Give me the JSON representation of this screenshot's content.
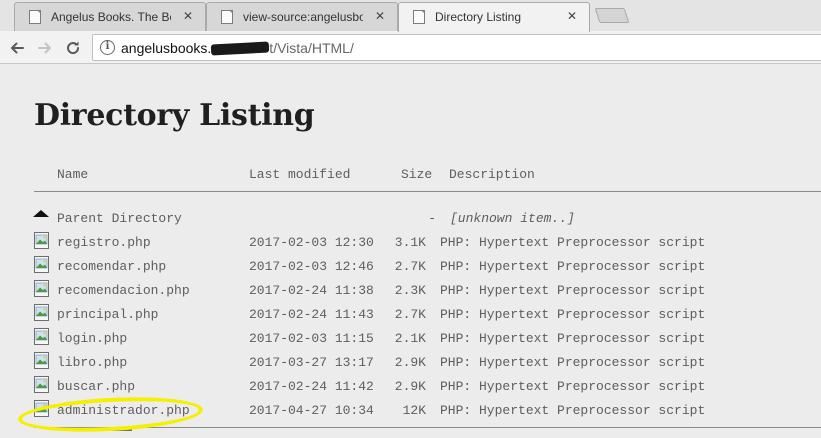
{
  "browser": {
    "tabs": [
      {
        "title": "Angelus Books. The Best",
        "active": false
      },
      {
        "title": "view-source:angelusbook",
        "active": false
      },
      {
        "title": "Directory Listing",
        "active": true
      }
    ],
    "close_glyph": "✕",
    "nav": {
      "back_icon": "back-arrow-icon",
      "forward_icon": "forward-arrow-icon",
      "reload_icon": "reload-icon"
    },
    "address": {
      "host_visible": "angelusbooks.",
      "host_tail": "t",
      "path": "/Vista/HTML/"
    }
  },
  "listing": {
    "title": "Directory Listing",
    "columns": {
      "name": "Name",
      "modified": "Last modified",
      "size": "Size",
      "description": "Description"
    },
    "parent": {
      "name": "Parent Directory",
      "size": "-",
      "description": "[unknown item..]"
    },
    "rows": [
      {
        "name": "registro.php",
        "modified": "2017-02-03 12:30",
        "size": "3.1K",
        "description": "PHP: Hypertext Preprocessor script"
      },
      {
        "name": "recomendar.php",
        "modified": "2017-02-03 12:46",
        "size": "2.7K",
        "description": "PHP: Hypertext Preprocessor script"
      },
      {
        "name": "recomendacion.php",
        "modified": "2017-02-24 11:38",
        "size": "2.3K",
        "description": "PHP: Hypertext Preprocessor script"
      },
      {
        "name": "principal.php",
        "modified": "2017-02-24 11:43",
        "size": "2.7K",
        "description": "PHP: Hypertext Preprocessor script"
      },
      {
        "name": "login.php",
        "modified": "2017-02-03 11:15",
        "size": "2.1K",
        "description": "PHP: Hypertext Preprocessor script"
      },
      {
        "name": "libro.php",
        "modified": "2017-03-27 13:17",
        "size": "2.9K",
        "description": "PHP: Hypertext Preprocessor script"
      },
      {
        "name": "buscar.php",
        "modified": "2017-02-24 11:42",
        "size": "2.9K",
        "description": "PHP: Hypertext Preprocessor script"
      },
      {
        "name": "administrador.php",
        "modified": "2017-04-27 10:34",
        "size": "12K",
        "description": "PHP: Hypertext Preprocessor script"
      }
    ],
    "highlight_color": "#f4f000"
  }
}
